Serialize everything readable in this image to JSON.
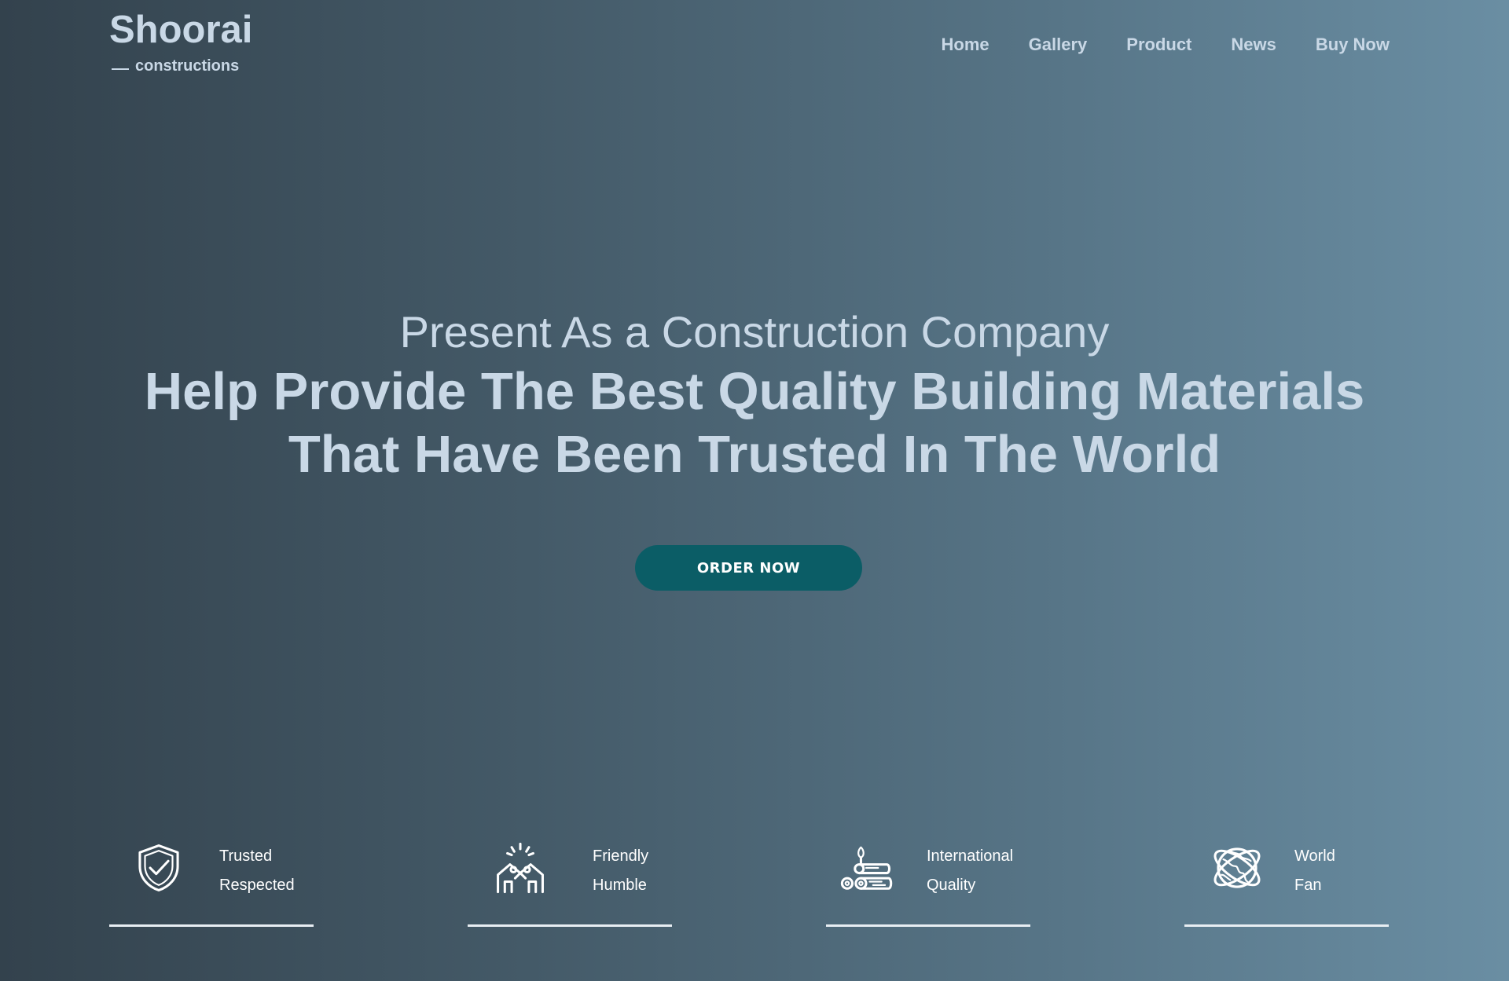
{
  "brand": {
    "name": "Shoorai",
    "tagline": "constructions"
  },
  "nav": {
    "items": [
      "Home",
      "Gallery",
      "Product",
      "News",
      "Buy Now"
    ]
  },
  "hero": {
    "subtitle": "Present As a Construction Company",
    "title_line1": "Help Provide The Best Quality Building Materials",
    "title_line2": "That Have Been Trusted In The World",
    "cta_label": "ORDER NOW"
  },
  "colors": {
    "text": "#c9d8e6",
    "cta_background": "#0b5d66",
    "feature_text": "#ffffff"
  },
  "features": [
    {
      "icon": "shield-check-icon",
      "line1": "Trusted",
      "line2": "Respected"
    },
    {
      "icon": "handshake-house-icon",
      "line1": "Friendly",
      "line2": "Humble"
    },
    {
      "icon": "logs-lumber-icon",
      "line1": "International",
      "line2": "Quality"
    },
    {
      "icon": "globe-orbit-icon",
      "line1": "World",
      "line2": "Fan"
    }
  ]
}
